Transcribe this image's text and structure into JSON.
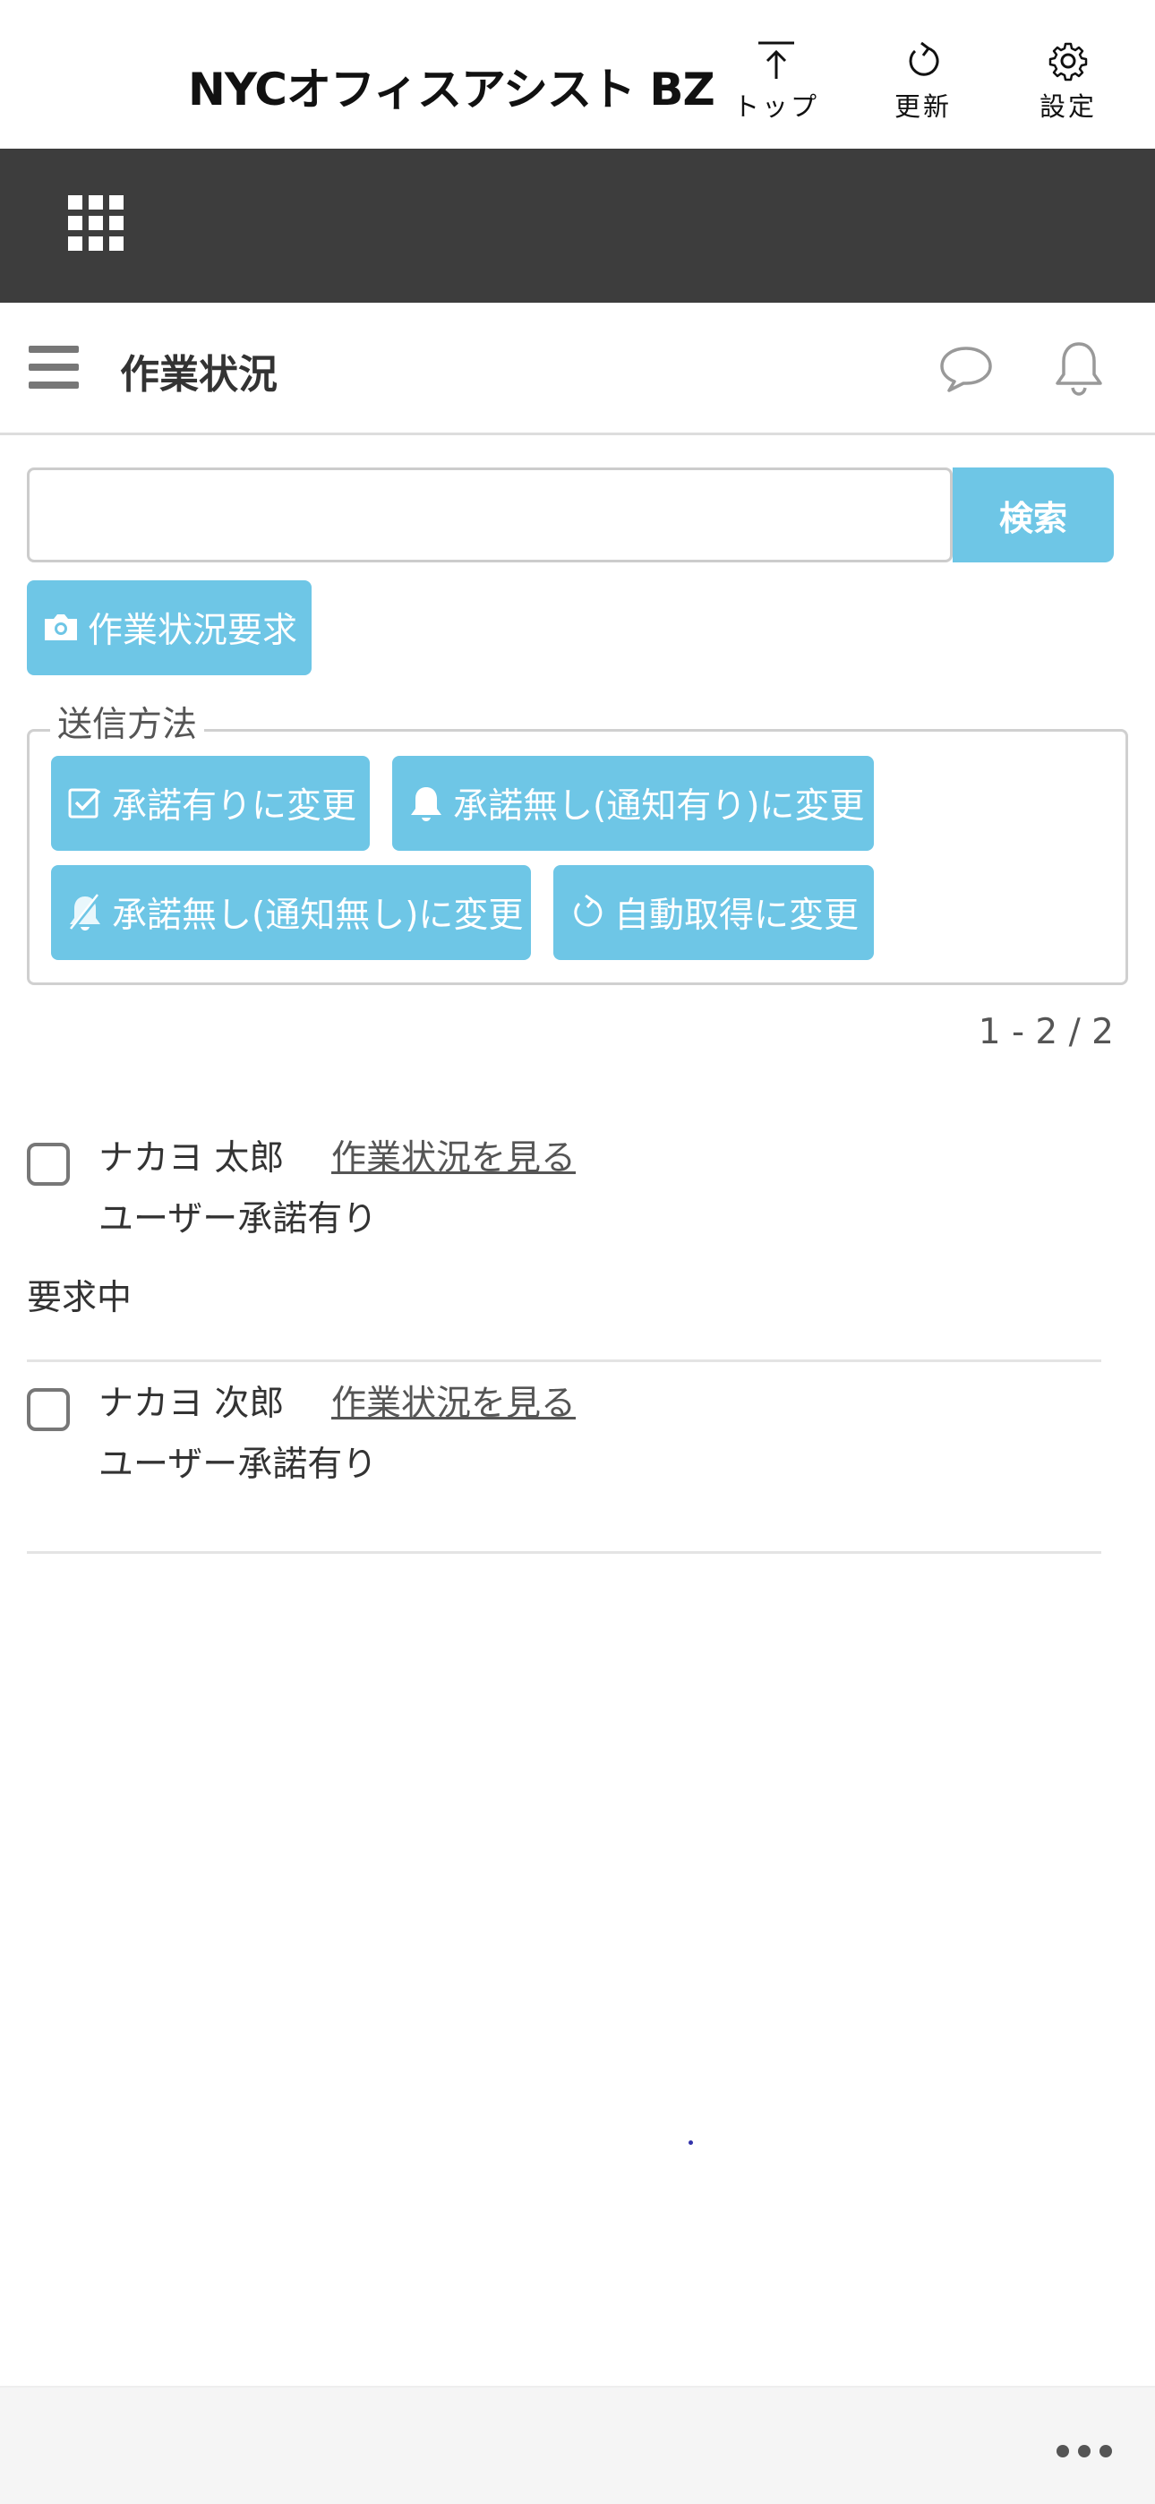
{
  "header": {
    "app_title": "NYCオフィスアシスト BZ",
    "top_label": "トップ",
    "refresh_label": "更新",
    "settings_label": "設定"
  },
  "page": {
    "title": "作業状況"
  },
  "search": {
    "value": "",
    "placeholder": "",
    "button_label": "検索"
  },
  "request_button": {
    "label": "作業状況要求",
    "icon": "camera-icon"
  },
  "send_method": {
    "legend": "送信方法",
    "buttons": [
      {
        "label": "承諾有りに変更",
        "icon": "checkbox-icon"
      },
      {
        "label": "承諾無し(通知有り)に変更",
        "icon": "bell-icon"
      },
      {
        "label": "承諾無し(通知無し)に変更",
        "icon": "bell-off-icon"
      },
      {
        "label": "自動取得に変更",
        "icon": "refresh-icon"
      }
    ]
  },
  "pagination": {
    "text": "1 - 2 / 2"
  },
  "users": [
    {
      "name": "ナカヨ 太郎",
      "link_label": "作業状況を見る",
      "status": "ユーザー承諾有り",
      "request_state": "要求中"
    },
    {
      "name": "ナカヨ 次郎",
      "link_label": "作業状況を見る",
      "status": "ユーザー承諾有り"
    }
  ],
  "colors": {
    "accent": "#6ec6e6",
    "dark_bar": "#3d3d3d"
  }
}
